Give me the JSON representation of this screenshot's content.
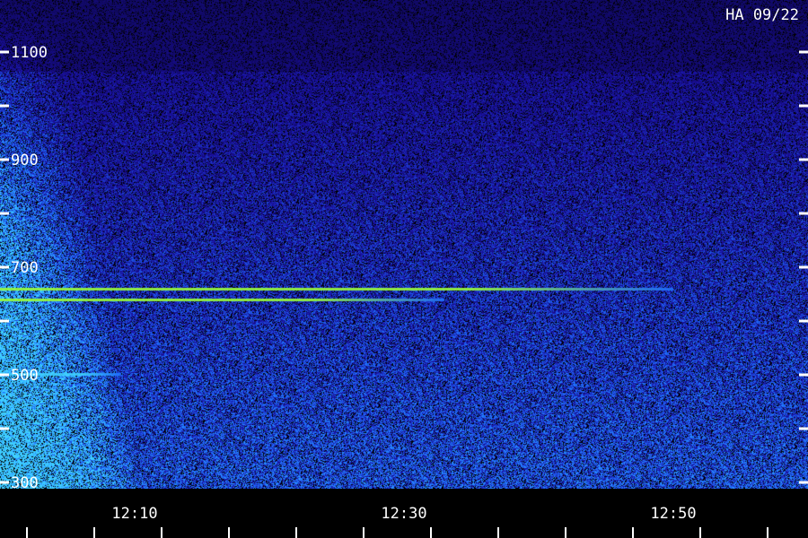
{
  "chart_data": {
    "type": "heatmap",
    "title": "HA 09/22",
    "colors": {
      "background": "#000000",
      "low": "#1a0fa0",
      "mid": "#1e6fff",
      "high": "#3fd0ff",
      "peak": "#9cff3a",
      "axis": "#ffffff"
    },
    "y_axis": {
      "range": [
        300,
        1200
      ],
      "ticks": [
        300,
        400,
        500,
        600,
        700,
        800,
        900,
        1000,
        1100
      ],
      "labeled_ticks": [
        {
          "value": 300,
          "label": "300"
        },
        {
          "value": 500,
          "label": "500"
        },
        {
          "value": 700,
          "label": "700"
        },
        {
          "value": 900,
          "label": "900"
        },
        {
          "value": 1100,
          "label": "1100"
        }
      ]
    },
    "x_axis": {
      "range_minutes": [
        12.0,
        72.0
      ],
      "labeled_ticks": [
        {
          "label": "12:10"
        },
        {
          "label": "12:30"
        },
        {
          "label": "12:50"
        }
      ]
    },
    "horizontal_lines": [
      {
        "frequency": 660,
        "time_end": "12:50",
        "intensity": "peak"
      },
      {
        "frequency": 640,
        "time_end": "12:33",
        "intensity": "peak"
      },
      {
        "frequency": 502,
        "time_end": "12:09",
        "intensity": "high"
      }
    ]
  }
}
